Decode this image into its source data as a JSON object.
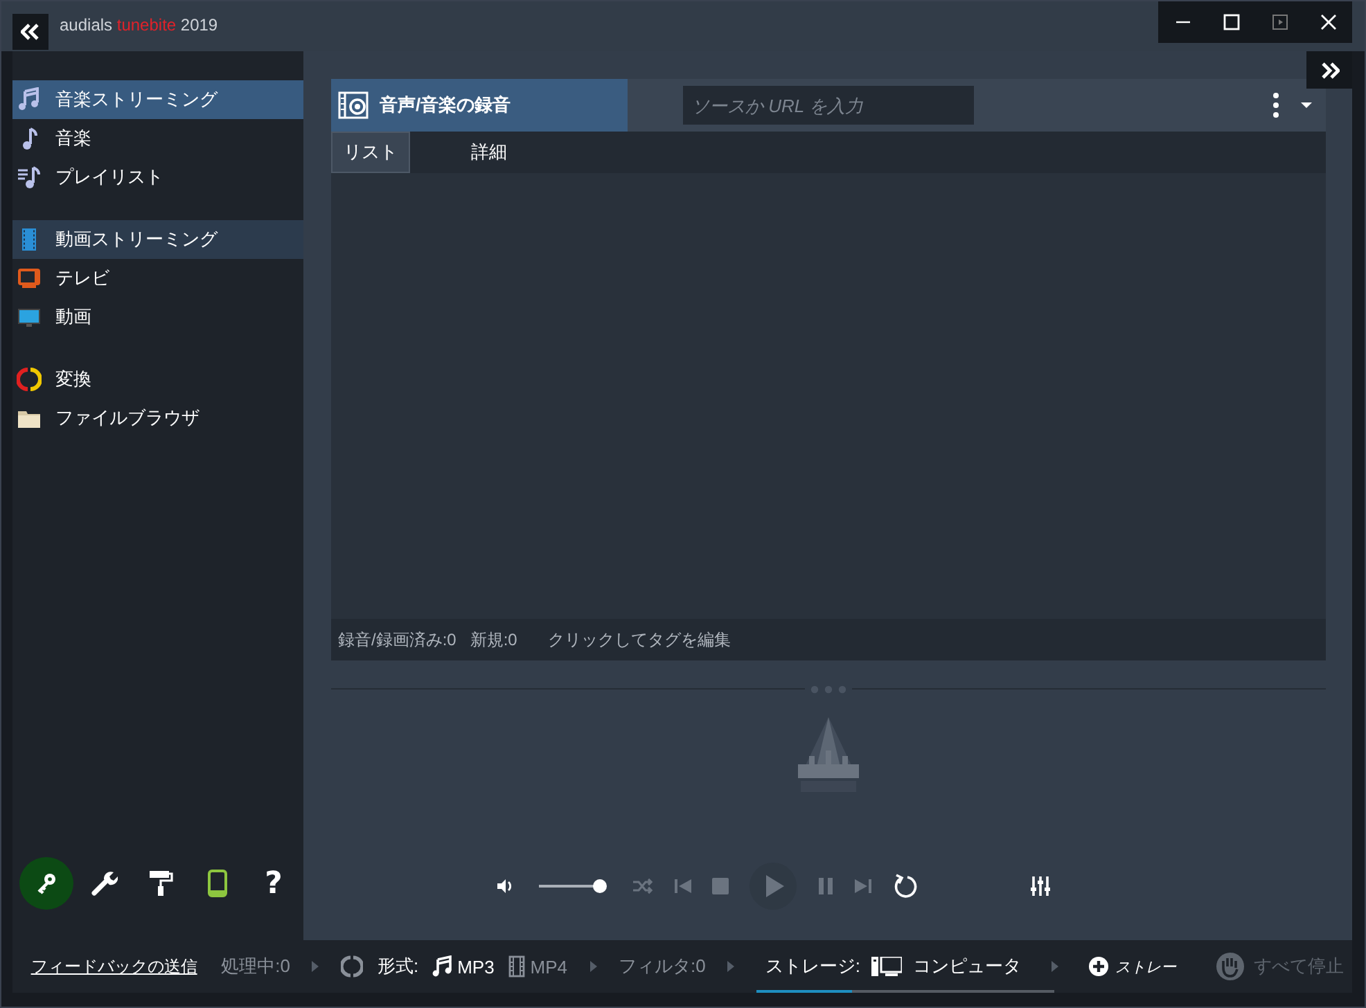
{
  "window": {
    "brand": "audials",
    "product": "tunebite",
    "year": "2019"
  },
  "sidebar": {
    "groups": [
      {
        "items": [
          {
            "label": "音楽ストリーミング",
            "selected": true,
            "hovered": false
          },
          {
            "label": "音楽",
            "selected": false,
            "hovered": false
          },
          {
            "label": "プレイリスト",
            "selected": false,
            "hovered": false
          }
        ]
      },
      {
        "items": [
          {
            "label": "動画ストリーミング",
            "selected": false,
            "hovered": true
          },
          {
            "label": "テレビ",
            "selected": false,
            "hovered": false
          },
          {
            "label": "動画",
            "selected": false,
            "hovered": false
          }
        ]
      },
      {
        "items": [
          {
            "label": "変換",
            "selected": false,
            "hovered": false
          },
          {
            "label": "ファイルブラウザ",
            "selected": false,
            "hovered": false
          }
        ]
      }
    ],
    "help": "?",
    "feedback_link": "フィードバックの送信"
  },
  "panel": {
    "title": "音声/音楽の録音",
    "search": {
      "placeholder": "ソースか URL を入力"
    },
    "tabs": [
      {
        "label": "リスト",
        "selected": true
      },
      {
        "label": "詳細",
        "selected": false
      }
    ],
    "stats": [
      "録音/録画済み:0",
      "新規:0",
      "クリックしてタグを編集"
    ]
  },
  "player": {
    "volume": {
      "level": 1
    }
  },
  "status_bar": {
    "processing": "処理中:0",
    "format_label": "形式:",
    "formats": [
      {
        "label": "MP3",
        "selected": true
      },
      {
        "label": "MP4",
        "selected": false
      }
    ],
    "filter": "フィルタ:0",
    "storage_label": "ストレージ:",
    "storage": "コンピュータ",
    "storage_usage": {
      "level": 0.32
    },
    "add_storage": "ストレー",
    "stop_all": {
      "label": "すべて停止",
      "disabled": true
    }
  }
}
